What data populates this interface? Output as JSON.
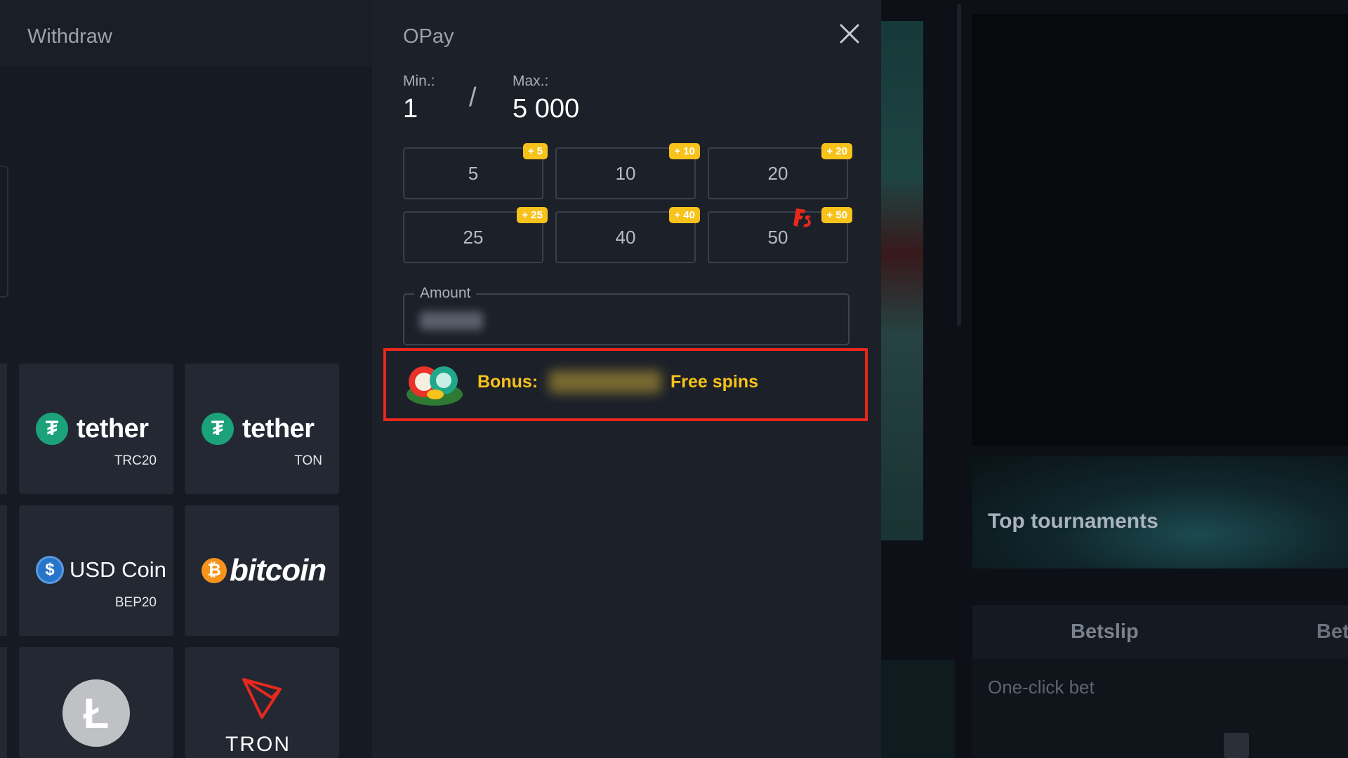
{
  "background": {
    "tournaments_title": "Top tournaments",
    "betslip_tab": "Betslip",
    "second_tab": "Bet",
    "one_click_bet": "One-click bet"
  },
  "withdraw": {
    "title": "Withdraw",
    "methods": [
      {
        "name": "tether",
        "network": "TRC20",
        "icon": "tether-icon"
      },
      {
        "name": "tether",
        "network": "TON",
        "icon": "tether-icon"
      },
      {
        "name": "USD Coin",
        "network": "BEP20",
        "icon": "usdc-icon"
      },
      {
        "name": "bitcoin",
        "network": "",
        "icon": "bitcoin-icon"
      },
      {
        "name": "",
        "network": "",
        "icon": "litecoin-icon"
      },
      {
        "name": "TRON",
        "network": "",
        "icon": "tron-icon"
      }
    ]
  },
  "opay": {
    "title": "OPay",
    "min_label": "Min.:",
    "min_value": "1",
    "separator": "/",
    "max_label": "Max.:",
    "max_value": "5 000",
    "amounts": [
      {
        "value": "5",
        "bonus": "+ 5"
      },
      {
        "value": "10",
        "bonus": "+ 10"
      },
      {
        "value": "20",
        "bonus": "+ 20"
      },
      {
        "value": "25",
        "bonus": "+ 25"
      },
      {
        "value": "40",
        "bonus": "+ 40"
      },
      {
        "value": "50",
        "bonus": "+ 50",
        "extra_icon": "free-spins-icon"
      }
    ],
    "amount_label": "Amount",
    "bonus_label": "Bonus:",
    "bonus_suffix": "Free spins"
  },
  "colors": {
    "accent_yellow": "#f7c21a",
    "highlight_red": "#e8281d",
    "tether_green": "#1ba27a",
    "bitcoin_orange": "#f7931a",
    "usdc_blue": "#2775ca",
    "tron_red": "#e8281d"
  }
}
